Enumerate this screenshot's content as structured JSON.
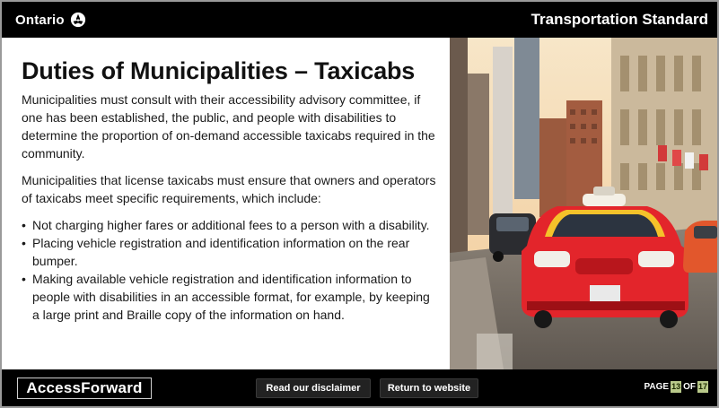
{
  "header": {
    "brand": "Ontario",
    "brand_icon": "trillium-icon",
    "section": "Transportation Standard"
  },
  "main": {
    "heading": "Duties of Municipalities – Taxicabs",
    "paragraphs": [
      "Municipalities must consult with their accessibility advisory committee, if one has been established, the public, and people with disabilities to determine the proportion of on-demand accessible taxicabs required in the community.",
      "Municipalities that license taxicabs must ensure that owners and operators of taxicabs meet specific requirements, which include:"
    ],
    "bullets": [
      "Not charging higher fares or additional fees to a person with a disability.",
      "Placing vehicle registration and identification information on the rear bumper.",
      "Making available vehicle registration and identification information to people with disabilities in an accessible format, for example, by keeping a large print and Braille copy of the information on hand."
    ],
    "image": "city-street-taxicab-photo"
  },
  "footer": {
    "logo": "AccessForward",
    "disclaimer_button": "Read our disclaimer",
    "return_button": "Return to website",
    "page_prefix": "PAGE",
    "page_current": "13",
    "page_of": "OF",
    "page_total": "17"
  },
  "colors": {
    "bar": "#000000",
    "page_badge": "#b9c98a",
    "taxi": "#e3252b"
  }
}
